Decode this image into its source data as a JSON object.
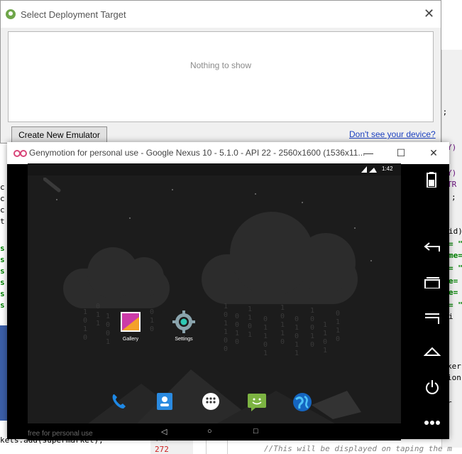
{
  "ide": {
    "line_numbers": [
      "272"
    ],
    "visible_code": {
      "line1": "kets.add(supermarket);",
      "line2": "//This will be displayed on taping the m"
    }
  },
  "deployment_dialog": {
    "title": "Select Deployment Target",
    "close_glyph": "✕",
    "empty_text": "Nothing to show",
    "create_button": "Create New Emulator",
    "help_link": "Don't see your device?"
  },
  "genymotion": {
    "title": "Genymotion for personal use - Google Nexus 10 - 5.1.0 - API 22 - 2560x1600 (1536x11...",
    "minimize_glyph": "—",
    "maximize_glyph": "☐",
    "close_glyph": "✕",
    "watermark": "free for personal use",
    "android": {
      "clock": "1:42",
      "apps": [
        {
          "label": "Gallery"
        },
        {
          "label": "Settings"
        }
      ],
      "dock": [
        "phone",
        "contacts",
        "app-drawer",
        "messenger",
        "browser"
      ],
      "nav": {
        "back": "◁",
        "home": "○",
        "recents": "□"
      }
    },
    "accent_color": "#d8467a"
  }
}
